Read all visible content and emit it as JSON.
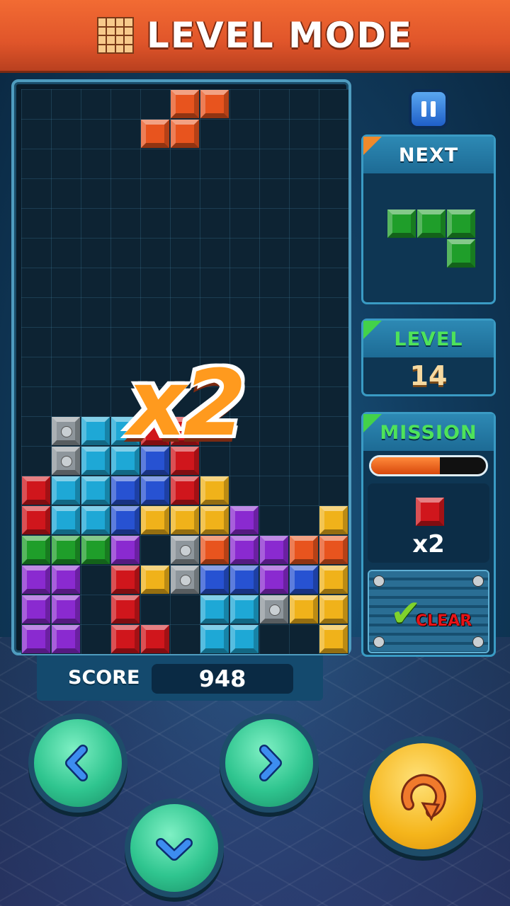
{
  "header": {
    "title": "LEVEL MODE",
    "icon": "grid-icon"
  },
  "board": {
    "cols": 11,
    "rows": 19,
    "falling_piece": [
      {
        "col": 5,
        "row": 0,
        "color": "orange"
      },
      {
        "col": 6,
        "row": 0,
        "color": "orange"
      },
      {
        "col": 4,
        "row": 1,
        "color": "orange"
      },
      {
        "col": 5,
        "row": 1,
        "color": "orange"
      }
    ],
    "stack": [
      [
        "-",
        "-",
        "-",
        "-",
        "-",
        "-",
        "-",
        "-",
        "-",
        "-",
        "-"
      ],
      [
        "-",
        "s",
        "c",
        "c",
        "r",
        "r",
        "-",
        "-",
        "-",
        "-",
        "-"
      ],
      [
        "-",
        "s",
        "c",
        "c",
        "b",
        "r",
        "-",
        "-",
        "-",
        "-",
        "-"
      ],
      [
        "r",
        "c",
        "c",
        "b",
        "b",
        "r",
        "y",
        "-",
        "-",
        "-",
        "-"
      ],
      [
        "r",
        "c",
        "c",
        "b",
        "y",
        "y",
        "y",
        "p",
        "-",
        "-",
        "y"
      ],
      [
        "g",
        "g",
        "g",
        "p",
        "-",
        "s",
        "o",
        "p",
        "p",
        "o",
        "o"
      ],
      [
        "p",
        "p",
        "-",
        "r",
        "y",
        "s",
        "b",
        "b",
        "p",
        "b",
        "y"
      ],
      [
        "p",
        "p",
        "-",
        "r",
        "-",
        "-",
        "c",
        "c",
        "s",
        "y",
        "y"
      ],
      [
        "p",
        "p",
        "-",
        "r",
        "r",
        "-",
        "c",
        "c",
        "-",
        "-",
        "y"
      ]
    ],
    "stack_top_row": 10,
    "combo_text": "x2"
  },
  "controls_top": {
    "pause_icon": "pause-icon"
  },
  "next": {
    "label": "NEXT",
    "color": "green",
    "cells": [
      [
        0,
        0
      ],
      [
        1,
        0
      ],
      [
        2,
        0
      ],
      [
        2,
        1
      ]
    ]
  },
  "level": {
    "label": "LEVEL",
    "value": "14"
  },
  "mission": {
    "label": "MISSION",
    "progress": 0.6,
    "target_color": "red",
    "target_count": "x2",
    "clear_label": "CLEAR"
  },
  "score": {
    "label": "SCORE",
    "value": "948"
  },
  "controls": [
    "left-arrow-icon",
    "down-arrow-icon",
    "right-arrow-icon",
    "rotate-icon"
  ],
  "colors": {
    "red": "#d0161c",
    "orange": "#e8541e",
    "cyan": "#1ea8d6",
    "blue": "#2752d2",
    "yellow": "#f0b21a",
    "purple": "#8a2ad0",
    "green": "#1f9e2a",
    "steel": "#8e969c",
    "header": "#e0552a"
  }
}
